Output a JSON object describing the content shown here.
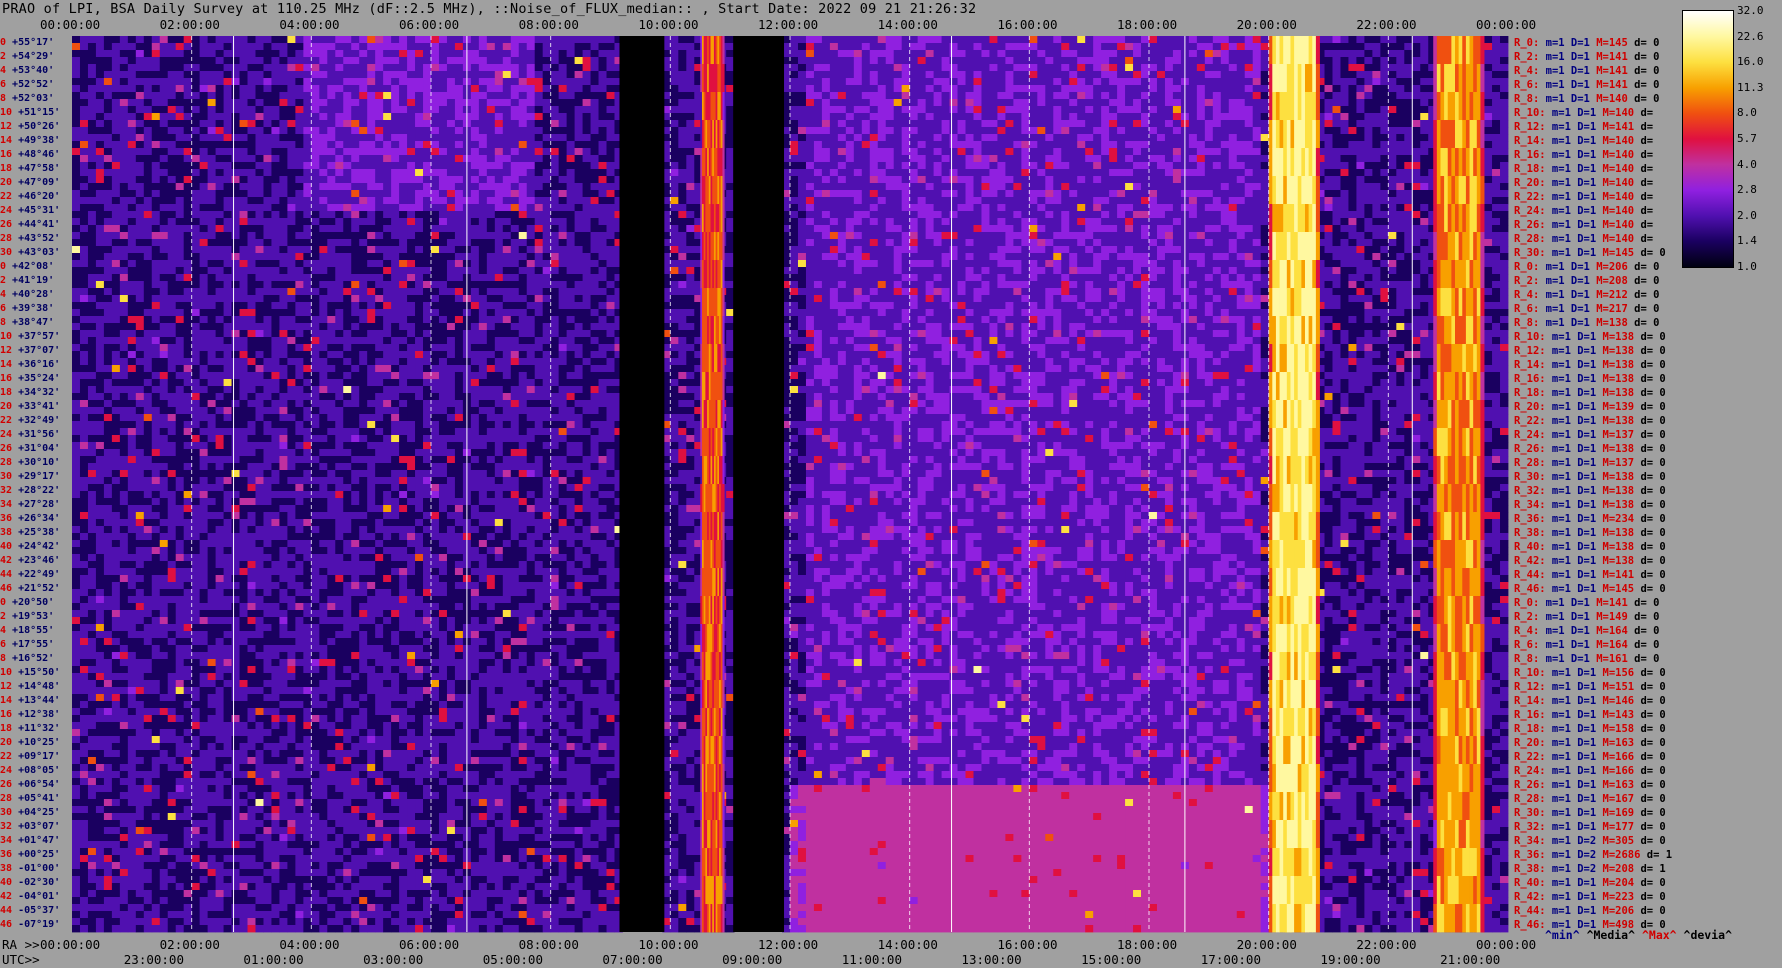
{
  "title": "PRAO of LPI, BSA Daily Survey at 110.25 MHz (dF::2.5 MHz), ::Noise_of_FLUX_median:: , Start Date: 2022 09 21 21:26:32",
  "chart_data": {
    "type": "heatmap",
    "title": "PRAO of LPI, BSA Daily Survey at 110.25 MHz (dF::2.5 MHz), ::Noise_of_FLUX_median:: , Start Date: 2022 09 21 21:26:32",
    "x_top_ticks": [
      "00:00:00",
      "02:00:00",
      "04:00:00",
      "06:00:00",
      "08:00:00",
      "10:00:00",
      "12:00:00",
      "14:00:00",
      "16:00:00",
      "18:00:00",
      "20:00:00",
      "22:00:00",
      "00:00:00"
    ],
    "ra_axis_label": "RA >>",
    "ra_ticks": [
      "00:00:00",
      "02:00:00",
      "04:00:00",
      "06:00:00",
      "08:00:00",
      "10:00:00",
      "12:00:00",
      "14:00:00",
      "16:00:00",
      "18:00:00",
      "20:00:00",
      "22:00:00",
      "00:00:00"
    ],
    "utc_axis_label": "UTC>>",
    "utc_ticks": [
      "23:00:00",
      "01:00:00",
      "03:00:00",
      "05:00:00",
      "07:00:00",
      "09:00:00",
      "11:00:00",
      "13:00:00",
      "15:00:00",
      "17:00:00",
      "19:00:00",
      "21:00:00"
    ],
    "declinations": [
      "+55°17'",
      "+54°29'",
      "+53°40'",
      "+52°52'",
      "+52°03'",
      "+51°15'",
      "+50°26'",
      "+49°38'",
      "+48°46'",
      "+47°58'",
      "+47°09'",
      "+46°20'",
      "+45°31'",
      "+44°41'",
      "+43°52'",
      "+43°03'",
      "+42°08'",
      "+41°19'",
      "+40°28'",
      "+39°38'",
      "+38°47'",
      "+37°57'",
      "+37°07'",
      "+36°16'",
      "+35°24'",
      "+34°32'",
      "+33°41'",
      "+32°49'",
      "+31°56'",
      "+31°04'",
      "+30°10'",
      "+29°17'",
      "+28°22'",
      "+27°28'",
      "+26°34'",
      "+25°38'",
      "+24°42'",
      "+23°46'",
      "+22°49'",
      "+21°52'",
      "+20°50'",
      "+19°53'",
      "+18°55'",
      "+17°55'",
      "+16°52'",
      "+15°50'",
      "+14°48'",
      "+13°44'",
      "+12°38'",
      "+11°32'",
      "+10°25'",
      "+09°17'",
      "+08°05'",
      "+06°54'",
      "+05°41'",
      "+04°25'",
      "+03°07'",
      "+01°47'",
      "+00°25'",
      "-01°00'",
      "-02°30'",
      "-04°01'",
      "-05°37'",
      "-07°19'"
    ],
    "dec_indices": [
      "0",
      "2",
      "4",
      "6",
      "8",
      "10",
      "12",
      "14",
      "16",
      "18",
      "20",
      "22",
      "24",
      "26",
      "28",
      "30",
      "0",
      "2",
      "4",
      "6",
      "8",
      "10",
      "12",
      "14",
      "16",
      "18",
      "20",
      "22",
      "24",
      "26",
      "28",
      "30",
      "32",
      "34",
      "36",
      "38",
      "40",
      "42",
      "44",
      "46",
      "0",
      "2",
      "4",
      "6",
      "8",
      "10",
      "12",
      "14",
      "16",
      "18",
      "20",
      "22",
      "24",
      "26",
      "28",
      "30",
      "32",
      "34",
      "36",
      "38",
      "40",
      "42",
      "44",
      "46"
    ],
    "colorbar": {
      "ticks": [
        "32.0",
        "22.6",
        "16.0",
        "11.3",
        "8.0",
        "5.7",
        "4.0",
        "2.8",
        "2.0",
        "1.4",
        "1.0"
      ],
      "scale": "log",
      "range": [
        1.0,
        32.0
      ],
      "colors": [
        "#000010",
        "#1a0060",
        "#5010b0",
        "#9020e0",
        "#c030a0",
        "#e01040",
        "#f05010",
        "#f8a000",
        "#fde040",
        "#fff8a0",
        "#ffffff"
      ]
    },
    "bright_columns_hours": [
      {
        "start": 10.5,
        "end": 10.9,
        "level": 10
      },
      {
        "start": 20.0,
        "end": 20.85,
        "level": 24
      },
      {
        "start": 22.75,
        "end": 23.6,
        "level": 14
      }
    ],
    "dark_columns_hours": [
      {
        "start": 9.15,
        "end": 9.9
      },
      {
        "start": 11.05,
        "end": 11.9
      }
    ]
  },
  "stats": [
    {
      "r": "R_0:",
      "m": "m=1",
      "D": "D=1",
      "M": "M=145",
      "d": "d= 0"
    },
    {
      "r": "R_2:",
      "m": "m=1",
      "D": "D=1",
      "M": "M=141",
      "d": "d= 0"
    },
    {
      "r": "R_4:",
      "m": "m=1",
      "D": "D=1",
      "M": "M=141",
      "d": "d= 0"
    },
    {
      "r": "R_6:",
      "m": "m=1",
      "D": "D=1",
      "M": "M=141",
      "d": "d= 0"
    },
    {
      "r": "R_8:",
      "m": "m=1",
      "D": "D=1",
      "M": "M=140",
      "d": "d= 0"
    },
    {
      "r": "R_10:",
      "m": "m=1",
      "D": "D=1",
      "M": "M=140",
      "d": "d="
    },
    {
      "r": "R_12:",
      "m": "m=1",
      "D": "D=1",
      "M": "M=141",
      "d": "d="
    },
    {
      "r": "R_14:",
      "m": "m=1",
      "D": "D=1",
      "M": "M=140",
      "d": "d="
    },
    {
      "r": "R_16:",
      "m": "m=1",
      "D": "D=1",
      "M": "M=140",
      "d": "d="
    },
    {
      "r": "R_18:",
      "m": "m=1",
      "D": "D=1",
      "M": "M=140",
      "d": "d="
    },
    {
      "r": "R_20:",
      "m": "m=1",
      "D": "D=1",
      "M": "M=140",
      "d": "d="
    },
    {
      "r": "R_22:",
      "m": "m=1",
      "D": "D=1",
      "M": "M=140",
      "d": "d="
    },
    {
      "r": "R_24:",
      "m": "m=1",
      "D": "D=1",
      "M": "M=140",
      "d": "d="
    },
    {
      "r": "R_26:",
      "m": "m=1",
      "D": "D=1",
      "M": "M=140",
      "d": "d="
    },
    {
      "r": "R_28:",
      "m": "m=1",
      "D": "D=1",
      "M": "M=140",
      "d": "d="
    },
    {
      "r": "R_30:",
      "m": "m=1",
      "D": "D=1",
      "M": "M=145",
      "d": "d= 0"
    },
    {
      "r": "R_0:",
      "m": "m=1",
      "D": "D=1",
      "M": "M=206",
      "d": "d= 0"
    },
    {
      "r": "R_2:",
      "m": "m=1",
      "D": "D=1",
      "M": "M=208",
      "d": "d= 0"
    },
    {
      "r": "R_4:",
      "m": "m=1",
      "D": "D=1",
      "M": "M=212",
      "d": "d= 0"
    },
    {
      "r": "R_6:",
      "m": "m=1",
      "D": "D=1",
      "M": "M=217",
      "d": "d= 0"
    },
    {
      "r": "R_8:",
      "m": "m=1",
      "D": "D=1",
      "M": "M=138",
      "d": "d= 0"
    },
    {
      "r": "R_10:",
      "m": "m=1",
      "D": "D=1",
      "M": "M=138",
      "d": "d= 0"
    },
    {
      "r": "R_12:",
      "m": "m=1",
      "D": "D=1",
      "M": "M=138",
      "d": "d= 0"
    },
    {
      "r": "R_14:",
      "m": "m=1",
      "D": "D=1",
      "M": "M=138",
      "d": "d= 0"
    },
    {
      "r": "R_16:",
      "m": "m=1",
      "D": "D=1",
      "M": "M=138",
      "d": "d= 0"
    },
    {
      "r": "R_18:",
      "m": "m=1",
      "D": "D=1",
      "M": "M=138",
      "d": "d= 0"
    },
    {
      "r": "R_20:",
      "m": "m=1",
      "D": "D=1",
      "M": "M=139",
      "d": "d= 0"
    },
    {
      "r": "R_22:",
      "m": "m=1",
      "D": "D=1",
      "M": "M=138",
      "d": "d= 0"
    },
    {
      "r": "R_24:",
      "m": "m=1",
      "D": "D=1",
      "M": "M=137",
      "d": "d= 0"
    },
    {
      "r": "R_26:",
      "m": "m=1",
      "D": "D=1",
      "M": "M=138",
      "d": "d= 0"
    },
    {
      "r": "R_28:",
      "m": "m=1",
      "D": "D=1",
      "M": "M=137",
      "d": "d= 0"
    },
    {
      "r": "R_30:",
      "m": "m=1",
      "D": "D=1",
      "M": "M=138",
      "d": "d= 0"
    },
    {
      "r": "R_32:",
      "m": "m=1",
      "D": "D=1",
      "M": "M=138",
      "d": "d= 0"
    },
    {
      "r": "R_34:",
      "m": "m=1",
      "D": "D=1",
      "M": "M=138",
      "d": "d= 0"
    },
    {
      "r": "R_36:",
      "m": "m=1",
      "D": "D=1",
      "M": "M=234",
      "d": "d= 0"
    },
    {
      "r": "R_38:",
      "m": "m=1",
      "D": "D=1",
      "M": "M=138",
      "d": "d= 0"
    },
    {
      "r": "R_40:",
      "m": "m=1",
      "D": "D=1",
      "M": "M=138",
      "d": "d= 0"
    },
    {
      "r": "R_42:",
      "m": "m=1",
      "D": "D=1",
      "M": "M=138",
      "d": "d= 0"
    },
    {
      "r": "R_44:",
      "m": "m=1",
      "D": "D=1",
      "M": "M=141",
      "d": "d= 0"
    },
    {
      "r": "R_46:",
      "m": "m=1",
      "D": "D=1",
      "M": "M=145",
      "d": "d= 0"
    },
    {
      "r": "R_0:",
      "m": "m=1",
      "D": "D=1",
      "M": "M=141",
      "d": "d= 0"
    },
    {
      "r": "R_2:",
      "m": "m=1",
      "D": "D=1",
      "M": "M=149",
      "d": "d= 0"
    },
    {
      "r": "R_4:",
      "m": "m=1",
      "D": "D=1",
      "M": "M=164",
      "d": "d= 0"
    },
    {
      "r": "R_6:",
      "m": "m=1",
      "D": "D=1",
      "M": "M=164",
      "d": "d= 0"
    },
    {
      "r": "R_8:",
      "m": "m=1",
      "D": "D=1",
      "M": "M=161",
      "d": "d= 0"
    },
    {
      "r": "R_10:",
      "m": "m=1",
      "D": "D=1",
      "M": "M=156",
      "d": "d= 0"
    },
    {
      "r": "R_12:",
      "m": "m=1",
      "D": "D=1",
      "M": "M=151",
      "d": "d= 0"
    },
    {
      "r": "R_14:",
      "m": "m=1",
      "D": "D=1",
      "M": "M=146",
      "d": "d= 0"
    },
    {
      "r": "R_16:",
      "m": "m=1",
      "D": "D=1",
      "M": "M=143",
      "d": "d= 0"
    },
    {
      "r": "R_18:",
      "m": "m=1",
      "D": "D=1",
      "M": "M=158",
      "d": "d= 0"
    },
    {
      "r": "R_20:",
      "m": "m=1",
      "D": "D=1",
      "M": "M=163",
      "d": "d= 0"
    },
    {
      "r": "R_22:",
      "m": "m=1",
      "D": "D=1",
      "M": "M=166",
      "d": "d= 0"
    },
    {
      "r": "R_24:",
      "m": "m=1",
      "D": "D=1",
      "M": "M=166",
      "d": "d= 0"
    },
    {
      "r": "R_26:",
      "m": "m=1",
      "D": "D=1",
      "M": "M=163",
      "d": "d= 0"
    },
    {
      "r": "R_28:",
      "m": "m=1",
      "D": "D=1",
      "M": "M=167",
      "d": "d= 0"
    },
    {
      "r": "R_30:",
      "m": "m=1",
      "D": "D=1",
      "M": "M=169",
      "d": "d= 0"
    },
    {
      "r": "R_32:",
      "m": "m=1",
      "D": "D=1",
      "M": "M=177",
      "d": "d= 0"
    },
    {
      "r": "R_34:",
      "m": "m=1",
      "D": "D=2",
      "M": "M=305",
      "d": "d= 0"
    },
    {
      "r": "R_36:",
      "m": "m=1",
      "D": "D=2",
      "M": "M=2686",
      "d": "d= 1"
    },
    {
      "r": "R_38:",
      "m": "m=1",
      "D": "D=2",
      "M": "M=208",
      "d": "d= 1"
    },
    {
      "r": "R_40:",
      "m": "m=1",
      "D": "D=1",
      "M": "M=204",
      "d": "d= 0"
    },
    {
      "r": "R_42:",
      "m": "m=1",
      "D": "D=1",
      "M": "M=223",
      "d": "d= 0"
    },
    {
      "r": "R_44:",
      "m": "m=1",
      "D": "D=1",
      "M": "M=206",
      "d": "d= 0"
    },
    {
      "r": "R_46:",
      "m": "m=1",
      "D": "D=1",
      "M": "M=498",
      "d": "d= 0"
    }
  ],
  "legend": {
    "min": "^min^",
    "media": "^Media^",
    "max": "^Max^",
    "devia": "^devia^"
  }
}
